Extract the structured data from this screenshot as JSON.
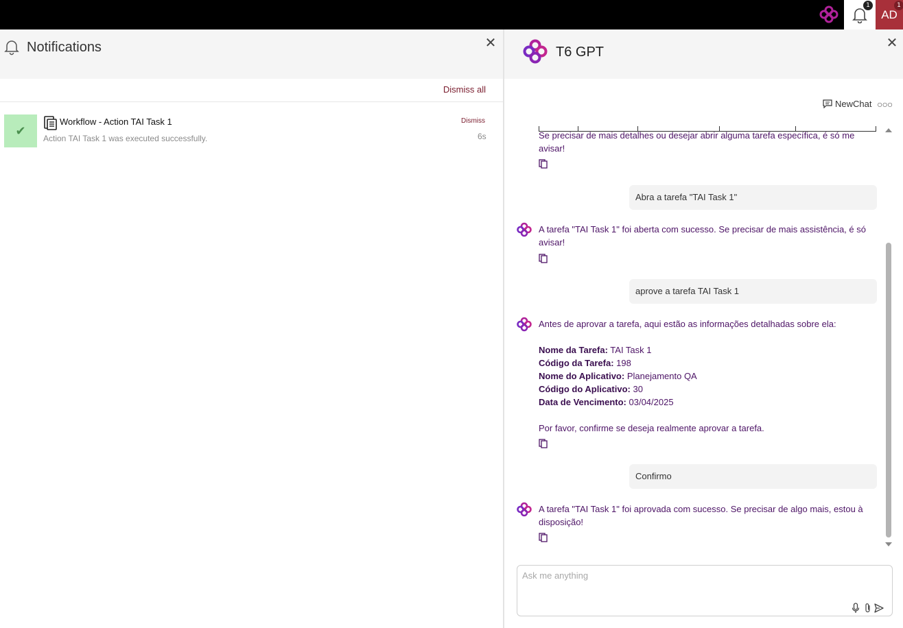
{
  "topbar": {
    "bell_badge": "1",
    "avatar_initials": "AD",
    "avatar_badge": "1",
    "colors": {
      "avatar_bg": "#a8303a",
      "brand": "#b0229a"
    }
  },
  "notifications": {
    "title": "Notifications",
    "dismiss_all": "Dismiss all",
    "items": [
      {
        "title": "Workflow - Action TAI Task 1",
        "message": "Action TAI Task 1 was executed successfully.",
        "dismiss": "Dismiss",
        "time": "6s",
        "status": "success",
        "icon": "document-icon"
      }
    ]
  },
  "gpt": {
    "title": "T6 GPT",
    "newchat": "NewChat",
    "input_placeholder": "Ask me anything",
    "messages": [
      {
        "role": "bot",
        "text": "Se precisar de mais detalhes ou desejar abrir alguma tarefa específica, é só me avisar!"
      },
      {
        "role": "user",
        "text": "Abra a tarefa \"TAI Task 1\""
      },
      {
        "role": "bot",
        "text": "A tarefa \"TAI Task 1\" foi aberta com sucesso. Se precisar de mais assistência, é só avisar!"
      },
      {
        "role": "user",
        "text": "aprove a tarefa TAI Task 1"
      },
      {
        "role": "bot",
        "intro": "Antes de aprovar a tarefa, aqui estão as informações detalhadas sobre ela:",
        "fields": [
          {
            "label": "Nome da Tarefa:",
            "value": "TAI Task 1"
          },
          {
            "label": "Código da Tarefa:",
            "value": "198"
          },
          {
            "label": "Nome do Aplicativo:",
            "value": "Planejamento QA"
          },
          {
            "label": "Código do Aplicativo:",
            "value": "30"
          },
          {
            "label": "Data de Vencimento:",
            "value": "03/04/2025"
          }
        ],
        "outro": "Por favor, confirme se deseja realmente aprovar a tarefa."
      },
      {
        "role": "user",
        "text": "Confirmo"
      },
      {
        "role": "bot",
        "text": "A tarefa \"TAI Task 1\" foi aprovada com sucesso. Se precisar de algo mais, estou à disposição!"
      }
    ]
  }
}
